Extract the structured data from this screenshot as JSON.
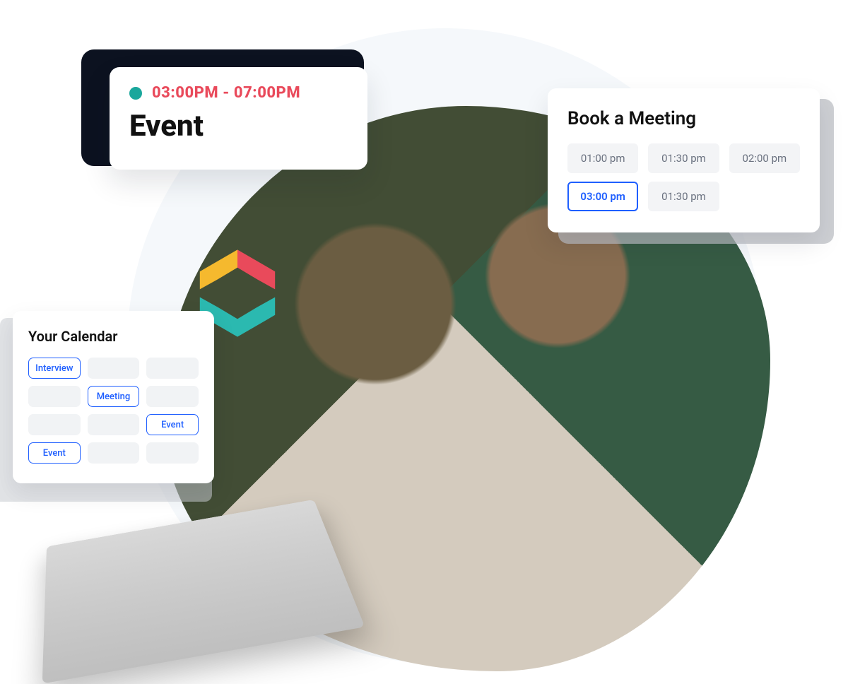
{
  "event_card": {
    "status_color": "#1aa79c",
    "time_range": "03:00PM - 07:00PM",
    "title": "Event"
  },
  "meeting_card": {
    "title": "Book a Meeting",
    "slots": [
      {
        "label": "01:00 pm",
        "selected": false
      },
      {
        "label": "01:30 pm",
        "selected": false
      },
      {
        "label": "02:00 pm",
        "selected": false
      },
      {
        "label": "03:00 pm",
        "selected": true
      },
      {
        "label": "01:30 pm",
        "selected": false
      }
    ]
  },
  "calendar_card": {
    "title": "Your Calendar",
    "entries": [
      {
        "label": "Interview",
        "filled": true
      },
      {
        "label": "",
        "filled": false
      },
      {
        "label": "",
        "filled": false
      },
      {
        "label": "",
        "filled": false
      },
      {
        "label": "Meeting",
        "filled": true
      },
      {
        "label": "",
        "filled": false
      },
      {
        "label": "",
        "filled": false
      },
      {
        "label": "",
        "filled": false
      },
      {
        "label": "Event",
        "filled": true
      },
      {
        "label": "Event",
        "filled": true
      },
      {
        "label": "",
        "filled": false
      },
      {
        "label": "",
        "filled": false
      }
    ]
  },
  "logo": {
    "colors": {
      "top": "#e94a5b",
      "left": "#f5b92e",
      "bottom": "#2bb9b0"
    }
  }
}
